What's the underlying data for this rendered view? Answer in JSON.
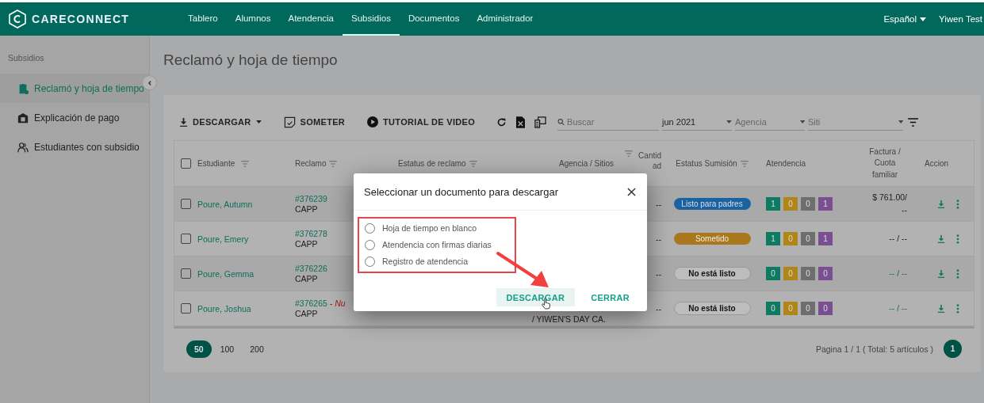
{
  "brand": "CARECONNECT",
  "nav": [
    {
      "label": "Tablero",
      "selected": false
    },
    {
      "label": "Alumnos",
      "selected": false
    },
    {
      "label": "Atendencia",
      "selected": false
    },
    {
      "label": "Subsidios",
      "selected": true
    },
    {
      "label": "Documentos",
      "selected": false
    },
    {
      "label": "Administrador",
      "selected": false
    }
  ],
  "language": "Español",
  "user": "Yiwen Test",
  "sidebar": {
    "heading": "Subsidios",
    "items": [
      {
        "label": "Reclamó y hoja de tiempo",
        "selected": true
      },
      {
        "label": "Explicación de pago",
        "selected": false
      },
      {
        "label": "Estudiantes con subsidio",
        "selected": false
      }
    ]
  },
  "page_title": "Reclamó y hoja de tiempo",
  "toolbar": {
    "buttons": [
      "DESCARGAR",
      "SOMETER",
      "TUTORIAL DE VIDEO"
    ],
    "search": {
      "placeholder": "Buscar"
    },
    "month": {
      "value": "jun 2021"
    },
    "agency": {
      "placeholder": "Agencia"
    },
    "site": {
      "placeholder": "Siti"
    }
  },
  "table": {
    "all_checked": false,
    "columns": [
      {
        "label": "Estudiante",
        "filter": true
      },
      {
        "label": "Reclamo",
        "filter": true
      },
      {
        "label": "Estatus de reclamo",
        "filter": true
      },
      {
        "label": "Agencia / Sitios",
        "filter": false
      },
      {
        "label": "Cantidad",
        "filter": true
      },
      {
        "label": "Estatus Sumisión",
        "filter": true
      },
      {
        "label": "Atendencia",
        "filter": false
      },
      {
        "label": "Factura / Cuota familiar",
        "filter": false
      },
      {
        "label": "Accion",
        "filter": false
      }
    ],
    "rows": [
      {
        "checked": false,
        "student": "Poure, Autumn",
        "claim": "#376239",
        "program": "CAPP",
        "amount": "--",
        "submission": {
          "kind": "ready",
          "label": "Listo para padres"
        },
        "attendance": [
          {
            "value": "1",
            "color": "#0e7a62"
          },
          {
            "value": "0",
            "color": "#b08618"
          },
          {
            "value": "0",
            "color": "#6e6e6e"
          },
          {
            "value": "1",
            "color": "#7a4f92"
          }
        ],
        "invoice": {
          "lines": [
            "$ 761.00/",
            "--"
          ],
          "link": false
        }
      },
      {
        "checked": false,
        "student": "Poure, Emery",
        "claim": "#376278",
        "program": "CAPP",
        "amount": "--",
        "submission": {
          "kind": "submitted",
          "label": "Sometido"
        },
        "attendance": [
          {
            "value": "1",
            "color": "#0e7a62"
          },
          {
            "value": "0",
            "color": "#b08618"
          },
          {
            "value": "0",
            "color": "#6e6e6e"
          },
          {
            "value": "1",
            "color": "#7a4f92"
          }
        ],
        "invoice": {
          "lines": [
            "-- / --"
          ],
          "link": false
        }
      },
      {
        "checked": false,
        "student": "Poure, Gemma",
        "claim": "#376226",
        "program": "CAPP",
        "amount": "--",
        "submission": {
          "kind": "not_ready",
          "label": "No está listo"
        },
        "attendance": [
          {
            "value": "0",
            "color": "#0e7a62"
          },
          {
            "value": "0",
            "color": "#b08618"
          },
          {
            "value": "0",
            "color": "#6e6e6e"
          },
          {
            "value": "0",
            "color": "#7a4f92"
          }
        ],
        "invoice": {
          "lines": [
            "-- / --"
          ],
          "link": true
        }
      },
      {
        "checked": false,
        "student": "Poure, Joshua",
        "claim": "#376265",
        "note": "- Nu",
        "program": "CAPP",
        "agency": "/ YIWEN'S DAY CA.",
        "amount": "--",
        "submission": {
          "kind": "not_ready",
          "label": "No está listo"
        },
        "attendance": [
          {
            "value": "0",
            "color": "#0e7a62"
          },
          {
            "value": "0",
            "color": "#b08618"
          },
          {
            "value": "0",
            "color": "#6e6e6e"
          },
          {
            "value": "0",
            "color": "#7a4f92"
          }
        ],
        "invoice": {
          "lines": [
            "-- / --"
          ],
          "link": true
        }
      }
    ]
  },
  "page_sizes": [
    {
      "label": "50",
      "selected": true
    },
    {
      "label": "100",
      "selected": false
    },
    {
      "label": "200",
      "selected": false
    }
  ],
  "pagination": {
    "summary": "Pagina 1 / 1 ( Total: 5 artículos )",
    "page": "1"
  },
  "dialog": {
    "title": "Seleccionar un documento para descargar",
    "options": [
      {
        "label": "Hoja de tiempo en blanco",
        "selected": false
      },
      {
        "label": "Atendencia con firmas diarias",
        "selected": false
      },
      {
        "label": "Registro de atendencia",
        "selected": false
      }
    ],
    "primary": "DESCARGAR",
    "secondary": "CERRAR"
  }
}
